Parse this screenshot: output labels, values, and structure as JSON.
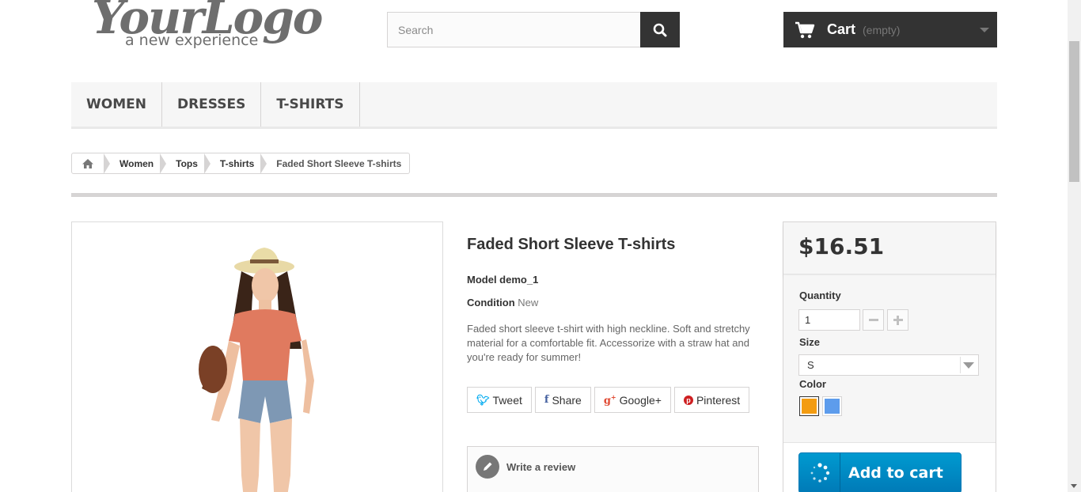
{
  "header": {
    "logo_script": "YourLogo",
    "logo_tagline": "a new experience",
    "search_placeholder": "Search",
    "cart_title": "Cart",
    "cart_status": "(empty)"
  },
  "menu": {
    "items": [
      {
        "label": "WOMEN"
      },
      {
        "label": "DRESSES"
      },
      {
        "label": "T-SHIRTS"
      }
    ]
  },
  "breadcrumb": {
    "items": [
      "Women",
      "Tops",
      "T-shirts",
      "Faded Short Sleeve T-shirts"
    ]
  },
  "product": {
    "title": "Faded Short Sleeve T-shirts",
    "model_text": "Model demo_1",
    "condition_label": "Condition",
    "condition_value": "New",
    "description": "Faded short sleeve t-shirt with high neckline. Soft and stretchy material for a comfortable fit. Accessorize with a straw hat and you're ready for summer!"
  },
  "social": {
    "tweet": "Tweet",
    "share": "Share",
    "google": "Google+",
    "pinterest": "Pinterest"
  },
  "review": {
    "label": "Write a review"
  },
  "buy": {
    "price": "$16.51",
    "quantity_label": "Quantity",
    "quantity_value": "1",
    "size_label": "Size",
    "size_value": "S",
    "color_label": "Color",
    "colors": [
      "#f39c11",
      "#5d9cec"
    ],
    "add_to_cart": "Add to cart"
  },
  "colors": {
    "dark": "#333333",
    "accent_blue": "#009ad0",
    "twitter": "#00aaf0",
    "facebook": "#435f9f",
    "google": "#e04b34",
    "pinterest": "#ce1f21"
  }
}
